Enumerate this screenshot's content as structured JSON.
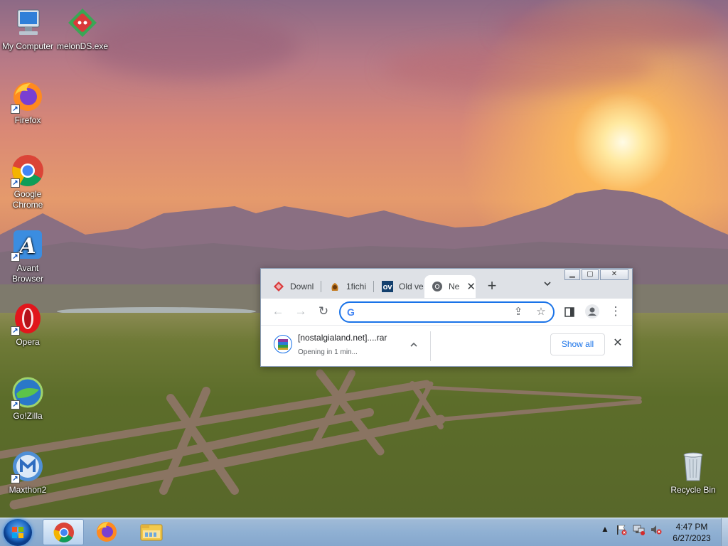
{
  "desktop": {
    "icons": [
      {
        "label": "My Computer",
        "icon": "computer-icon"
      },
      {
        "label": "melonDS.exe",
        "icon": "melonds-icon"
      },
      {
        "label": "Firefox",
        "icon": "firefox-icon"
      },
      {
        "label": "Google Chrome",
        "icon": "chrome-icon"
      },
      {
        "label": "Avant Browser",
        "icon": "avant-browser-icon"
      },
      {
        "label": "Opera",
        "icon": "opera-icon"
      },
      {
        "label": "Go!Zilla",
        "icon": "gozilla-icon"
      },
      {
        "label": "Maxthon2",
        "icon": "maxthon-icon"
      },
      {
        "label": "Recycle Bin",
        "icon": "recycle-bin-icon"
      }
    ]
  },
  "browser": {
    "tabs": [
      {
        "title": "Downl",
        "favicon": "download-site-icon"
      },
      {
        "title": "1fichi",
        "favicon": "1fichier-icon"
      },
      {
        "title": "Old ve",
        "favicon": "ov-icon"
      },
      {
        "title": "Ne",
        "favicon": "chrome-icon",
        "active": true
      }
    ],
    "new_tab_symbol": "+",
    "omnibox": {
      "value": "",
      "placeholder": ""
    },
    "download": {
      "filename": "[nostalgialand.net]....rar",
      "status": "Opening in 1 min...",
      "show_all_label": "Show all"
    }
  },
  "taskbar": {
    "time": "4:47 PM",
    "date": "6/27/2023",
    "pinned": [
      "chrome-icon",
      "firefox-icon",
      "file-explorer-icon"
    ]
  },
  "colors": {
    "accent": "#1a73e8",
    "tabstrip": "#dee1e6"
  }
}
